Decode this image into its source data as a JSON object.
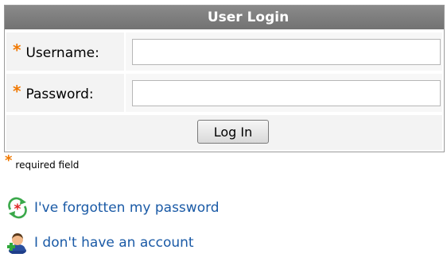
{
  "login": {
    "title": "User Login",
    "required_star": "*",
    "username_label": "Username:",
    "username_value": "",
    "password_label": "Password:",
    "password_value": "",
    "login_button": "Log In"
  },
  "required_note": {
    "star": "*",
    "text": "required field"
  },
  "links": {
    "forgot_password": {
      "text": "I've forgotten my password",
      "icon": "password-recovery-icon"
    },
    "no_account": {
      "text": "I don't have an account",
      "icon": "add-user-icon"
    }
  },
  "colors": {
    "header_bg": "#7d7d7d",
    "required_star": "#f07800",
    "link": "#1a5aa6"
  }
}
